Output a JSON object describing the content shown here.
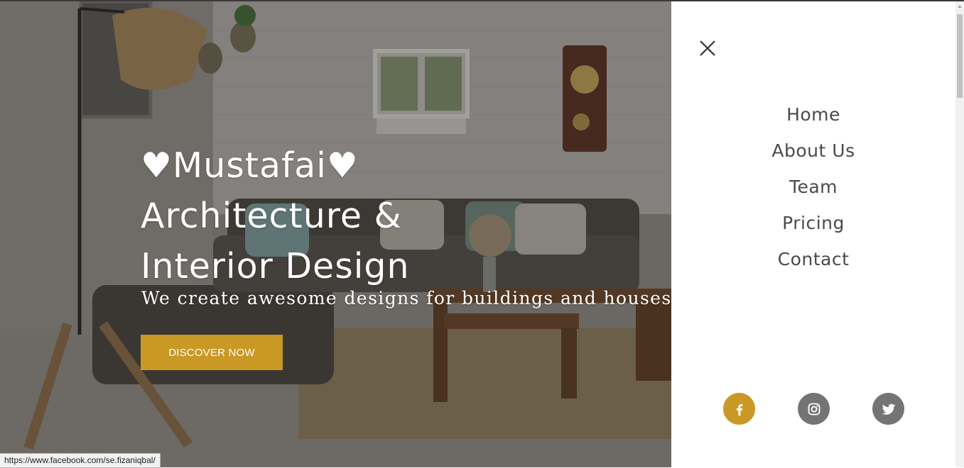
{
  "hero": {
    "title_line1": "♥Mustafai♥",
    "title_line2": "Architecture &",
    "title_line3": "Interior Design",
    "subtitle": "We create awesome designs for buildings and houses.",
    "cta_label": "DISCOVER NOW",
    "accent_color": "#c99825"
  },
  "status_bar": {
    "url": "https://www.facebook.com/se.fizaniqbal/"
  },
  "menu": {
    "close_icon": "close-icon",
    "items": [
      {
        "label": "Home"
      },
      {
        "label": "About Us"
      },
      {
        "label": "Team"
      },
      {
        "label": "Pricing"
      },
      {
        "label": "Contact"
      }
    ],
    "social": [
      {
        "icon": "facebook-icon",
        "color": "#c99825"
      },
      {
        "icon": "instagram-icon",
        "color": "#747474"
      },
      {
        "icon": "twitter-icon",
        "color": "#747474"
      }
    ]
  }
}
